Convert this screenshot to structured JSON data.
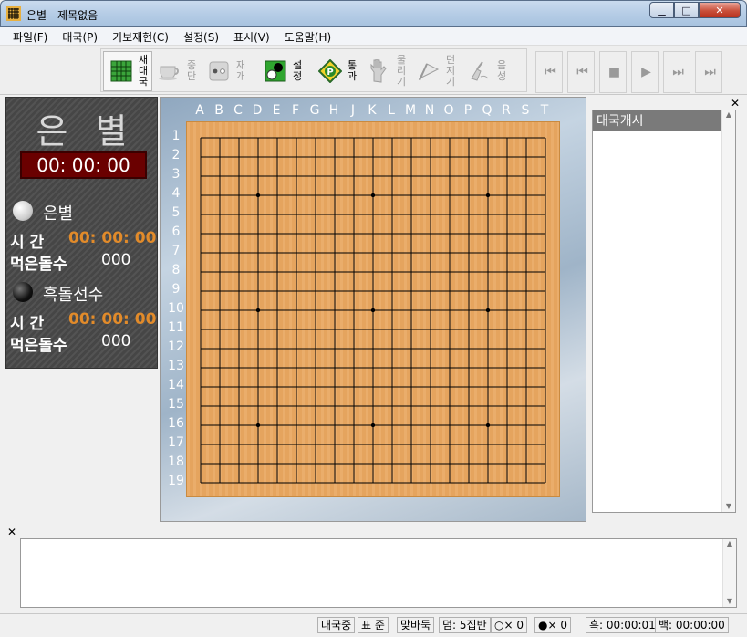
{
  "window": {
    "title": "은별 - 제목없음",
    "min": "▁",
    "max": "□",
    "close": "✕"
  },
  "menu": [
    "파일(F)",
    "대국(P)",
    "기보재현(C)",
    "설정(S)",
    "표시(V)",
    "도움말(H)"
  ],
  "toolbar": {
    "new_game": "새대국",
    "stop": "중단",
    "resume": "재개",
    "settings": "설정",
    "pass": "통과",
    "undo": "물리기",
    "resign": "던지기",
    "sound": "음성"
  },
  "nav": {
    "first": "⏮",
    "prev": "⏮",
    "stop": "■",
    "play": "▶",
    "next": "⏭",
    "last": "⏭"
  },
  "left_panel": {
    "brand": "은별",
    "main_clock": "00: 00: 00",
    "white_player": {
      "name": "은별",
      "time_label": "시 간",
      "time": "00: 00: 00",
      "captured_label": "먹은돌수",
      "captured": "000"
    },
    "black_player": {
      "name": "흑돌선수",
      "time_label": "시 간",
      "time": "00: 00: 00",
      "captured_label": "먹은돌수",
      "captured": "000"
    }
  },
  "board": {
    "size": 19,
    "columns": [
      "A",
      "B",
      "C",
      "D",
      "E",
      "F",
      "G",
      "H",
      "J",
      "K",
      "L",
      "M",
      "N",
      "O",
      "P",
      "Q",
      "R",
      "S",
      "T"
    ],
    "rows": [
      "1",
      "2",
      "3",
      "4",
      "5",
      "6",
      "7",
      "8",
      "9",
      "10",
      "11",
      "12",
      "13",
      "14",
      "15",
      "16",
      "17",
      "18",
      "19"
    ]
  },
  "log": {
    "items": [
      "대국개시"
    ]
  },
  "status": {
    "state": "대국중",
    "mode": "표 준",
    "game_type": "맞바둑",
    "komi": "덤: 5집반",
    "white_caps": "○× 0",
    "black_caps": "●× 0",
    "black_time": "흑: 00:00:01",
    "white_time": "백: 00:00:00"
  }
}
